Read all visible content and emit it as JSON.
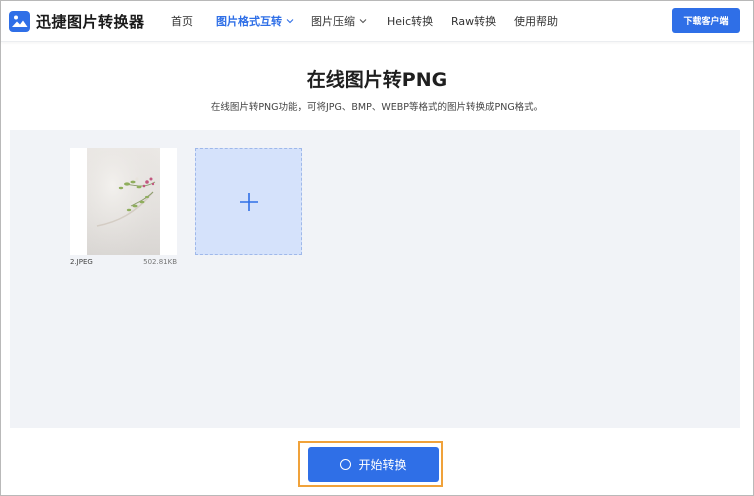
{
  "header": {
    "logo_text": "迅捷图片转换器",
    "nav": [
      {
        "label": "首页"
      },
      {
        "label": "图片格式互转"
      },
      {
        "label": "图片压缩"
      },
      {
        "label": "Heic转换"
      },
      {
        "label": "Raw转换"
      },
      {
        "label": "使用帮助"
      }
    ],
    "download_label": "下载客户端"
  },
  "main": {
    "title": "在线图片转PNG",
    "subtitle": "在线图片转PNG功能，可将JPG、BMP、WEBP等格式的图片转换成PNG格式。",
    "files": [
      {
        "name": "2.JPEG",
        "size": "502.81KB"
      }
    ],
    "add_icon": "plus-icon",
    "start_label": "开始转换"
  },
  "colors": {
    "accent": "#2f6fe7",
    "upload_bg": "#f1f3f7",
    "add_tile_bg": "#d5e2fb",
    "focus_ring": "#f0a23a"
  }
}
